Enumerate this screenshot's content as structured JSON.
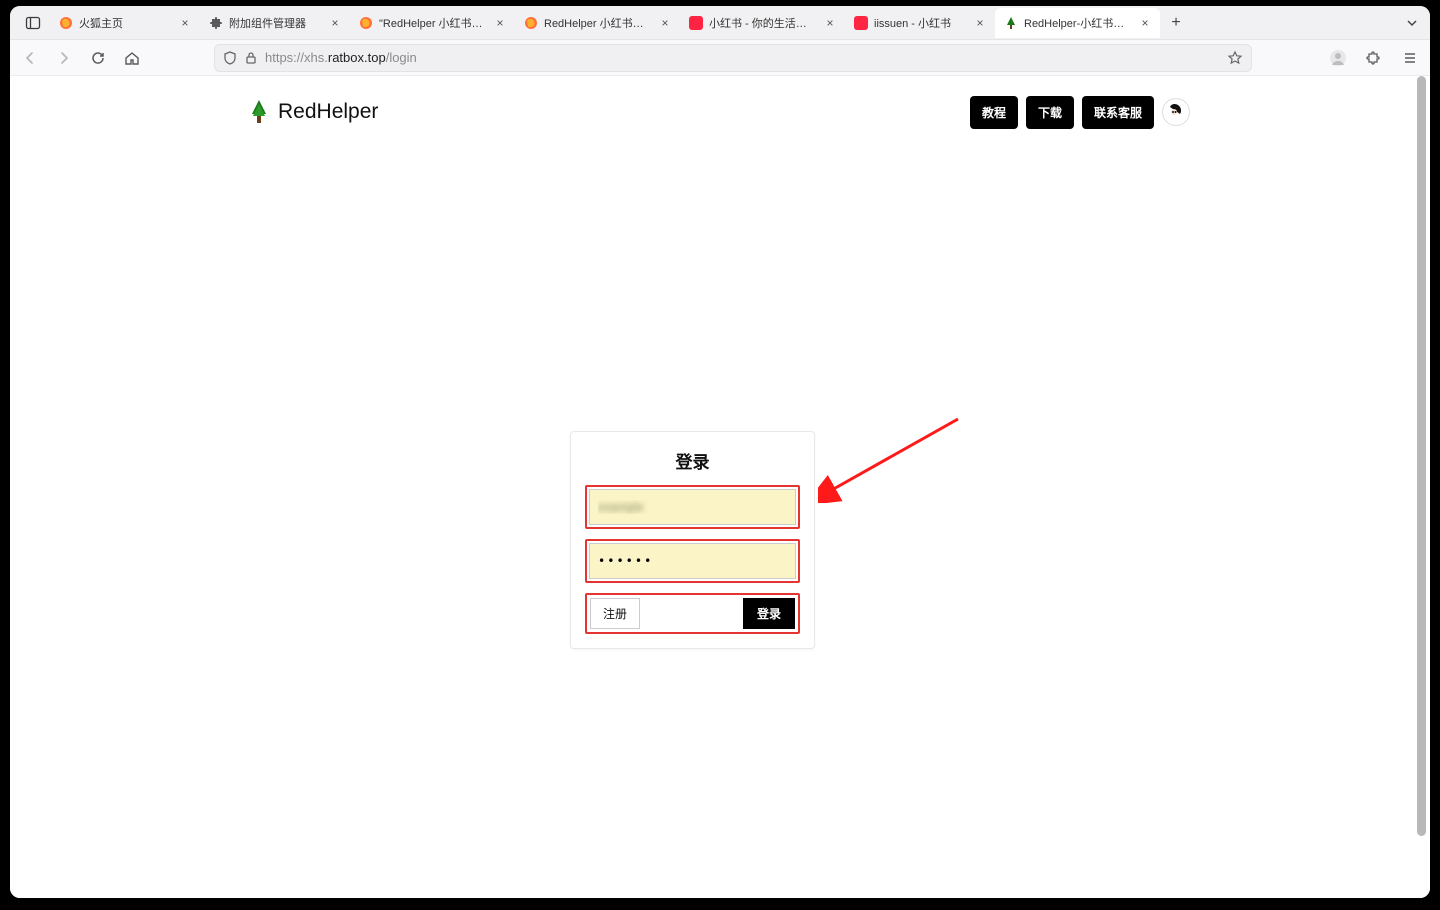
{
  "browser": {
    "tabs": [
      {
        "title": "火狐主页",
        "favicon": "firefox"
      },
      {
        "title": "附加组件管理器",
        "favicon": "puzzle"
      },
      {
        "title": "\"RedHelper 小红书采集助手\"的版",
        "favicon": "firefox"
      },
      {
        "title": "RedHelper 小红书采集助手 – 下载",
        "favicon": "firefox"
      },
      {
        "title": "小红书 - 你的生活指南",
        "favicon": "xhs"
      },
      {
        "title": "iissuen - 小红书",
        "favicon": "xhs"
      },
      {
        "title": "RedHelper-小红书视频、图片去水",
        "favicon": "tree",
        "active": true
      }
    ],
    "url_prefix": "https://xhs.",
    "url_host": "ratbox.top",
    "url_path": "/login"
  },
  "header": {
    "brand": "RedHelper",
    "buttons": {
      "tutorial": "教程",
      "download": "下载",
      "contact": "联系客服"
    }
  },
  "login": {
    "title": "登录",
    "username_blurred": "example",
    "password_masked": "••••••",
    "register": "注册",
    "submit": "登录"
  },
  "annotation": {
    "arrow_color": "#ff1a1a",
    "highlight_color": "#e53531"
  }
}
